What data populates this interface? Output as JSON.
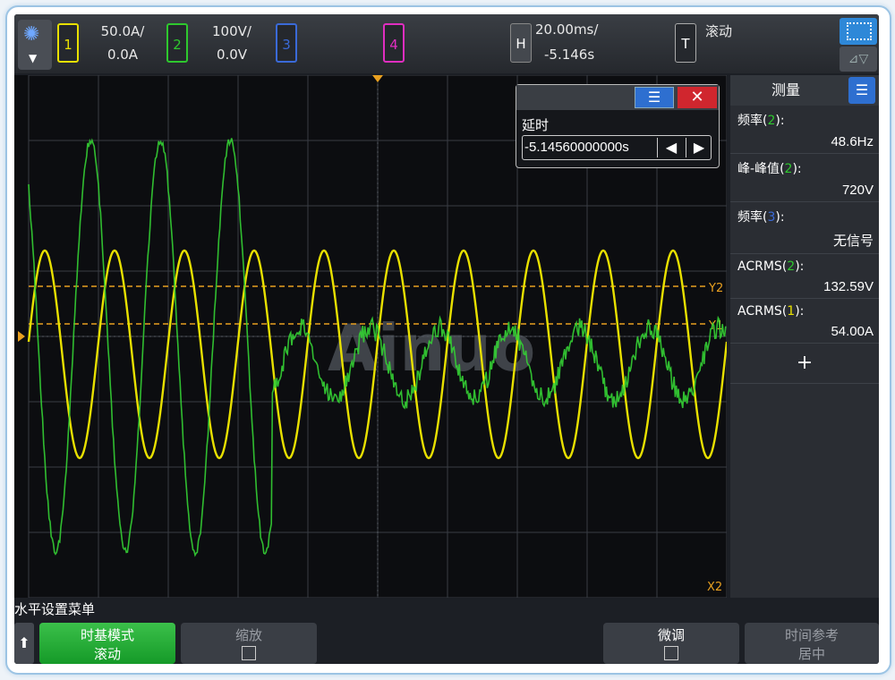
{
  "top": {
    "channels": [
      {
        "num": "1",
        "scale": "50.0A/",
        "offset": "0.0A",
        "color": "#e8e000"
      },
      {
        "num": "2",
        "scale": "100V/",
        "offset": "0.0V",
        "color": "#2ec82e"
      },
      {
        "num": "3",
        "color": "#3a6ad8"
      },
      {
        "num": "4",
        "color": "#e02ec0"
      }
    ],
    "horizontal": {
      "label": "H",
      "scale": "20.00ms/",
      "delay": "-5.146s"
    },
    "trigger": {
      "label": "T",
      "mode": "滚动"
    }
  },
  "cursors": {
    "y2": "Y2",
    "y1": "Y1",
    "x2": "X2"
  },
  "watermark": "Ainuo",
  "dialog": {
    "title": "延时",
    "value": "-5.14560000000s"
  },
  "measure": {
    "title": "测量",
    "items": [
      {
        "label": "频率",
        "ch": "2",
        "ch_color": "#2ec82e",
        "value": "48.6Hz"
      },
      {
        "label": "峰-峰值",
        "ch": "2",
        "ch_color": "#2ec82e",
        "value": "720V"
      },
      {
        "label": "频率",
        "ch": "3",
        "ch_color": "#3a6ad8",
        "value": "无信号"
      },
      {
        "label": "ACRMS",
        "ch": "2",
        "ch_color": "#2ec82e",
        "value": "132.59V"
      },
      {
        "label": "ACRMS",
        "ch": "1",
        "ch_color": "#e8e000",
        "value": "54.00A"
      }
    ],
    "add": "+"
  },
  "menu": {
    "title": "水平设置菜单",
    "softkeys": [
      {
        "label": "时基模式",
        "value": "滚动"
      },
      {
        "label": "缩放"
      },
      {
        "label": "微调"
      },
      {
        "label": "时间参考",
        "value": "居中"
      }
    ]
  }
}
